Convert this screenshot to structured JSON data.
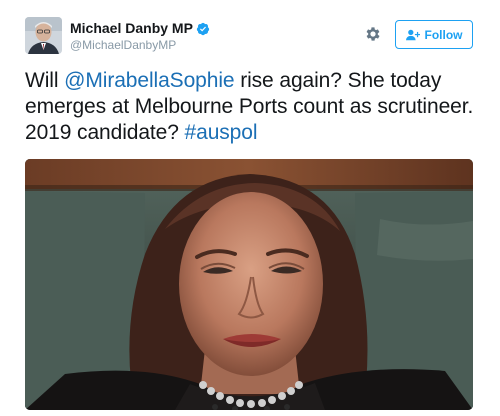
{
  "author": {
    "display_name": "Michael Danby MP",
    "handle": "@MichaelDanbyMP",
    "verified": true,
    "avatar_icon": "profile-photo"
  },
  "actions": {
    "settings_icon": "gear-icon",
    "follow_label": "Follow",
    "follow_icon": "add-user-icon"
  },
  "tweet": {
    "part1": "Will ",
    "mention": "@MirabellaSophie",
    "part2": " rise again? She today emerges at Melbourne Ports count as scrutineer. 2019 candidate? ",
    "hashtag": "#auspol"
  },
  "media": {
    "type": "photo",
    "subject": "woman seated on green bench"
  },
  "colors": {
    "link": "#1b6fb5",
    "accent": "#1da1f2",
    "handle": "#8899a6",
    "text": "#14171a"
  }
}
